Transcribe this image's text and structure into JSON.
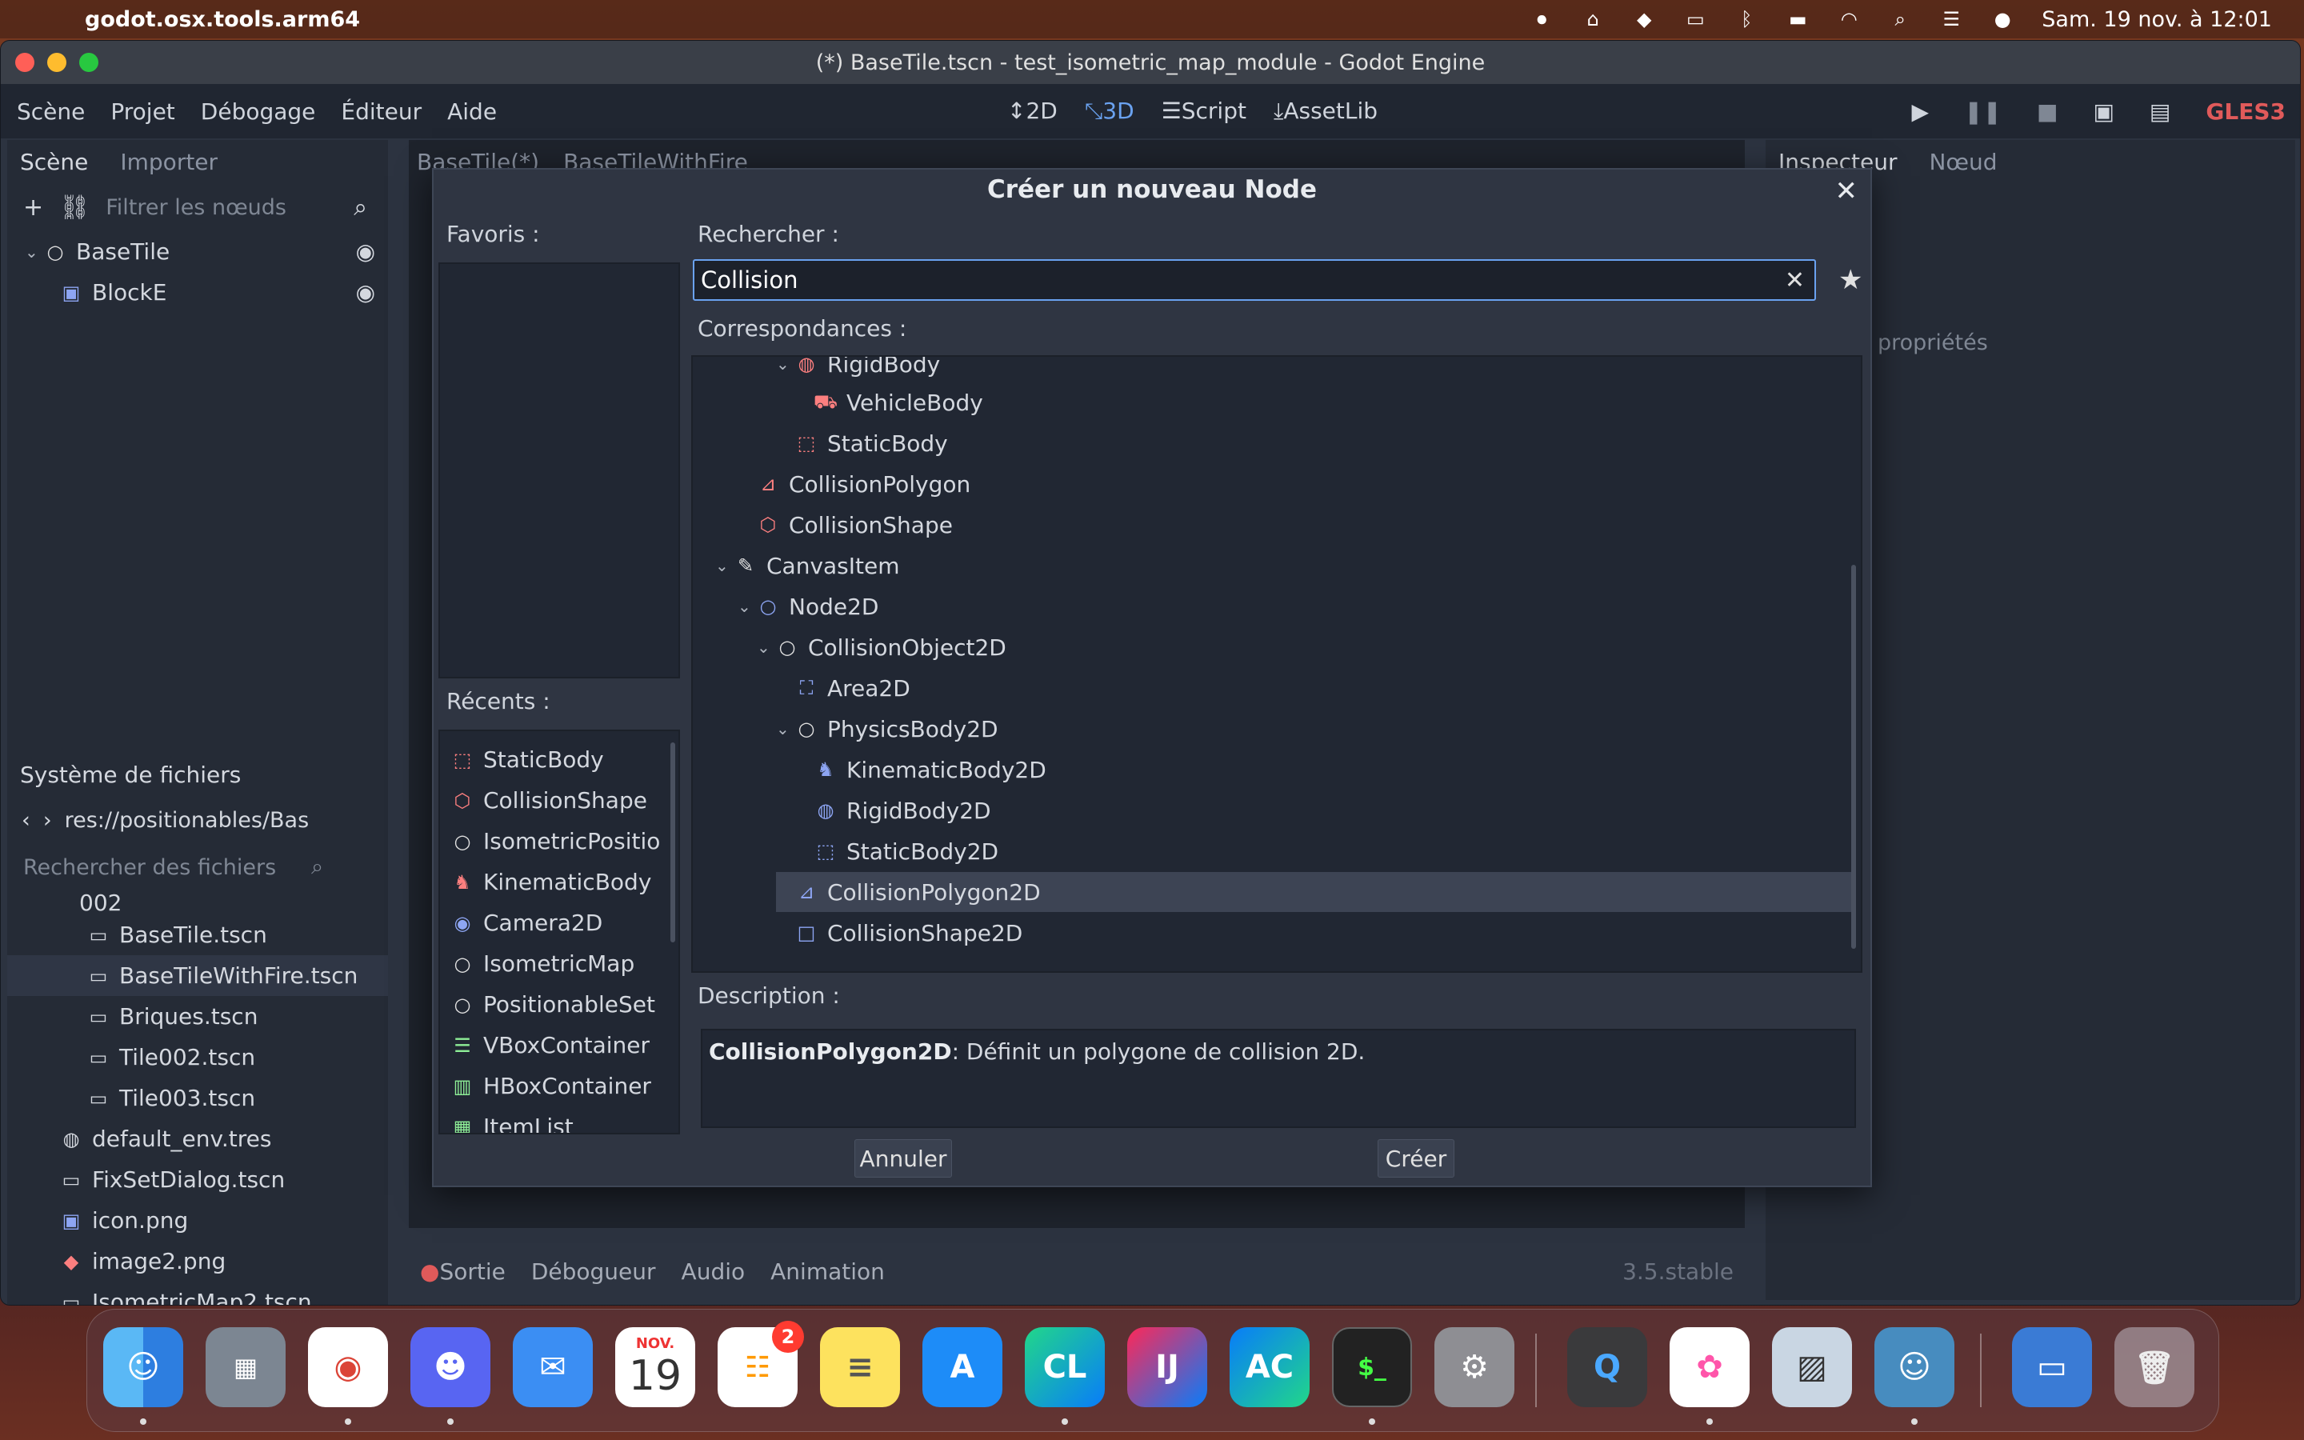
{
  "menubar": {
    "app_name": "godot.osx.tools.arm64",
    "datetime": "Sam. 19 nov. à 12:01"
  },
  "window": {
    "title": "(*) BaseTile.tscn - test_isometric_map_module - Godot Engine"
  },
  "main_menu": [
    "Scène",
    "Projet",
    "Débogage",
    "Éditeur",
    "Aide"
  ],
  "workspaces": [
    "2D",
    "3D",
    "Script",
    "AssetLib"
  ],
  "renderer": "GLES3",
  "scene_panel": {
    "tabs": [
      "Scène",
      "Importer"
    ],
    "filter_placeholder": "Filtrer les nœuds",
    "nodes": [
      "BaseTile",
      "BlockE"
    ]
  },
  "filesystem_panel": {
    "tab": "Système de fichiers",
    "path": "res://positionables/Bas",
    "search_placeholder": "Rechercher des fichiers",
    "items": [
      "002",
      "BaseTile.tscn",
      "BaseTileWithFire.tscn",
      "Briques.tscn",
      "Tile002.tscn",
      "Tile003.tscn",
      "default_env.tres",
      "FixSetDialog.tscn",
      "icon.png",
      "image2.png",
      "IsometricMap2.tscn"
    ]
  },
  "editor_tabs": [
    "BaseTile(*)",
    "BaseTileWithFire"
  ],
  "inspector_panel": {
    "tabs": [
      "Inspecteur",
      "Nœud"
    ],
    "filter_placeholder": "propriétés"
  },
  "bottom_panel": {
    "tabs": [
      "Sortie",
      "Débogueur",
      "Audio",
      "Animation"
    ],
    "version": "3.5.stable"
  },
  "dialog": {
    "title": "Créer un nouveau Node",
    "favorites_label": "Favoris :",
    "search_label": "Rechercher :",
    "search_value": "Collision",
    "matches_label": "Correspondances :",
    "recent_label": "Récents :",
    "description_label": "Description :",
    "description_class": "CollisionPolygon2D",
    "description_text": ": Définit un polygone de collision 2D.",
    "cancel_label": "Annuler",
    "create_label": "Créer",
    "matches": [
      {
        "label": "RigidBody",
        "icon": "rigidbody-icon",
        "enabled": true
      },
      {
        "label": "VehicleBody",
        "icon": "vehicle-icon",
        "enabled": true
      },
      {
        "label": "StaticBody",
        "icon": "staticbody-icon",
        "enabled": true
      },
      {
        "label": "CollisionPolygon",
        "icon": "polygon-icon",
        "enabled": true
      },
      {
        "label": "CollisionShape",
        "icon": "hexagon-icon",
        "enabled": true
      },
      {
        "label": "CanvasItem",
        "icon": "brush-icon",
        "enabled": false
      },
      {
        "label": "Node2D",
        "icon": "circle-icon",
        "enabled": true
      },
      {
        "label": "CollisionObject2D",
        "icon": "circle-icon",
        "enabled": false
      },
      {
        "label": "Area2D",
        "icon": "area-icon",
        "enabled": true
      },
      {
        "label": "PhysicsBody2D",
        "icon": "circle-icon",
        "enabled": false
      },
      {
        "label": "KinematicBody2D",
        "icon": "kinematic-icon",
        "enabled": true
      },
      {
        "label": "RigidBody2D",
        "icon": "rigidbody-icon",
        "enabled": true
      },
      {
        "label": "StaticBody2D",
        "icon": "staticbody-icon",
        "enabled": true
      },
      {
        "label": "CollisionPolygon2D",
        "icon": "polygon-icon",
        "enabled": true
      },
      {
        "label": "CollisionShape2D",
        "icon": "square-icon",
        "enabled": true
      }
    ],
    "recents": [
      "StaticBody",
      "CollisionShape",
      "IsometricPositio",
      "KinematicBody",
      "Camera2D",
      "IsometricMap",
      "PositionableSet",
      "VBoxContainer",
      "HBoxContainer",
      "ItemList"
    ]
  },
  "dock": {
    "calendar_month": "NOV.",
    "calendar_day": "19",
    "reminders_badge": "2",
    "apps": [
      "Finder",
      "Launchpad",
      "Chrome",
      "Discord",
      "Mail",
      "Calendar",
      "Reminders",
      "Notes",
      "App Store",
      "CLion",
      "IntelliJ IDEA",
      "AppCode",
      "Terminal",
      "System Preferences",
      "QuickTime",
      "Photos",
      "Preview",
      "Godot",
      "Downloads",
      "Trash"
    ],
    "labels": {
      "clion": "CL",
      "idea": "IJ",
      "appcode": "AC",
      "terminal": "$_"
    }
  },
  "colors": {
    "accent": "#6aa2f0",
    "node3d": "#fc7f7f",
    "node2d": "#8da5f3",
    "control": "#8eef97"
  }
}
